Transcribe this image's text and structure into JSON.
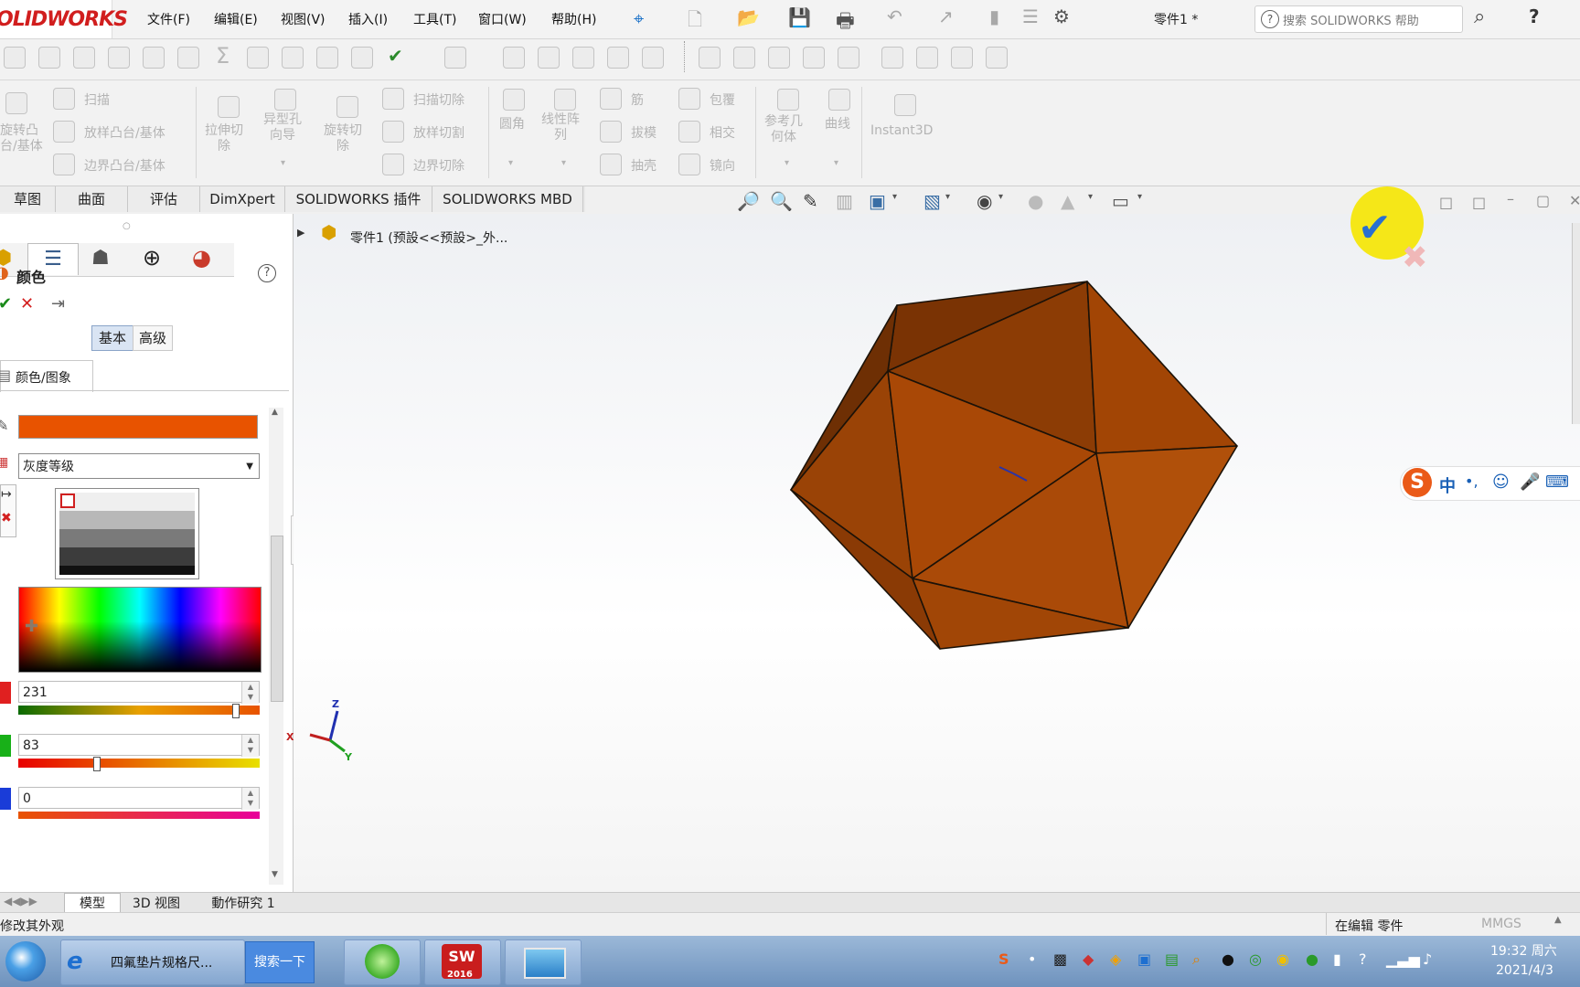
{
  "logo_text": "OLIDWORKS",
  "menu": [
    "文件(F)",
    "编辑(E)",
    "视图(V)",
    "插入(I)",
    "工具(T)",
    "窗口(W)",
    "帮助(H)"
  ],
  "doc_title": "零件1 *",
  "search_placeholder": "搜索 SOLIDWORKS 帮助",
  "help_glyph": "?",
  "ribbon": {
    "revolve": "旋转凸\n台/基体",
    "sweep": "扫描",
    "loft": "放样凸台/基体",
    "boundary": "边界凸台/基体",
    "extrude_cut": "拉伸切\n除",
    "hole_wizard": "异型孔\n向导",
    "revolve_cut": "旋转切\n除",
    "sweep_cut": "扫描切除",
    "loft_cut": "放样切割",
    "boundary_cut": "边界切除",
    "fillet": "圆角",
    "linear_pattern": "线性阵\n列",
    "rib": "筋",
    "draft": "拔模",
    "shell": "抽壳",
    "wrap": "包覆",
    "intersect": "相交",
    "mirror": "镜向",
    "ref_geometry": "参考几\n何体",
    "curves": "曲线",
    "instant3d": "Instant3D"
  },
  "tabs": [
    "草图",
    "曲面",
    "评估",
    "DimXpert",
    "SOLIDWORKS 插件",
    "SOLIDWORKS MBD"
  ],
  "tree": {
    "part_label": "零件1  (预設<<预設>_外..."
  },
  "property": {
    "title": "颜色",
    "help": "?",
    "basic": "基本",
    "advanced": "高级",
    "section": "颜色/图象",
    "color_mode": "灰度等级",
    "r": "231",
    "g": "83",
    "b": "0"
  },
  "colors": {
    "swatch": "#e85300",
    "part_face": "#a94806",
    "part_edge": "#1b1208",
    "r_channel": "#e02020",
    "g_channel": "#18b018",
    "b_channel": "#1a3cd8"
  },
  "ime": {
    "brand": "S",
    "mode": "中",
    "punct": "•,"
  },
  "triad": {
    "x": "X",
    "y": "Y",
    "z": "Z"
  },
  "bottom_tabs": [
    "模型",
    "3D 视图",
    "動作研究 1"
  ],
  "status": {
    "left": "修改其外观",
    "mode": "在编辑 零件",
    "units": "MMGS"
  },
  "taskbar": {
    "ie_task": "四氟垫片规格尺...",
    "search_btn": "搜索一下",
    "sw_label": "2016",
    "time": "19:32 周六",
    "date": "2021/4/3"
  }
}
